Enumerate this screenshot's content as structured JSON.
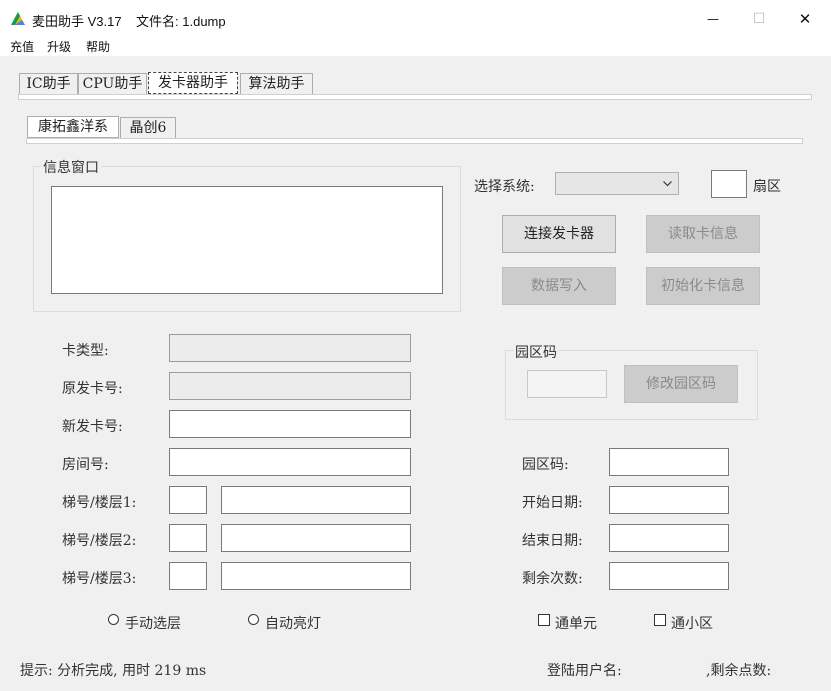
{
  "window": {
    "title": "麦田助手 V3.17    文件名: 1.dump",
    "minimize_glyph": "—",
    "maximize_glyph": "☐",
    "close_glyph": "✕"
  },
  "menu": [
    "充值",
    "升级",
    "帮助"
  ],
  "main_tabs": [
    "IC助手",
    "CPU助手",
    "发卡器助手",
    "算法助手"
  ],
  "sub_tabs": [
    "康拓鑫洋系",
    "晶创6"
  ],
  "info_window": {
    "title": "信息窗口",
    "content": ""
  },
  "system": {
    "label": "选择系统:",
    "selected": "",
    "sector_label": "扇区",
    "sector_value": ""
  },
  "buttons": {
    "connect": "连接发卡器",
    "read": "读取卡信息",
    "write": "数据写入",
    "init": "初始化卡信息",
    "modify_park": "修改园区码"
  },
  "park_group": {
    "title": "园区码",
    "value": ""
  },
  "left_fields": {
    "card_type": {
      "label": "卡类型:",
      "value": ""
    },
    "orig_card": {
      "label": "原发卡号:",
      "value": ""
    },
    "new_card": {
      "label": "新发卡号:",
      "value": ""
    },
    "room": {
      "label": "房间号:",
      "value": ""
    },
    "lift1": {
      "label": "梯号/楼层1:",
      "a": "",
      "b": ""
    },
    "lift2": {
      "label": "梯号/楼层2:",
      "a": "",
      "b": ""
    },
    "lift3": {
      "label": "梯号/楼层3:",
      "a": "",
      "b": ""
    }
  },
  "right_fields": {
    "park_code": {
      "label": "园区码:",
      "value": ""
    },
    "start_date": {
      "label": "开始日期:",
      "value": ""
    },
    "end_date": {
      "label": "结束日期:",
      "value": ""
    },
    "remaining": {
      "label": "剩余次数:",
      "value": ""
    }
  },
  "options": {
    "manual_floor": "手动选层",
    "auto_light": "自动亮灯",
    "unit": "通单元",
    "community": "通小区"
  },
  "status": {
    "hint": "提示: 分析完成, 用时 219 ms",
    "user": "登陆用户名:",
    "points": ",剩余点数:"
  },
  "colors": {
    "window_bg": "#f0f0f0",
    "disabled_button": "#cccccc",
    "panel": "#ffffff"
  }
}
